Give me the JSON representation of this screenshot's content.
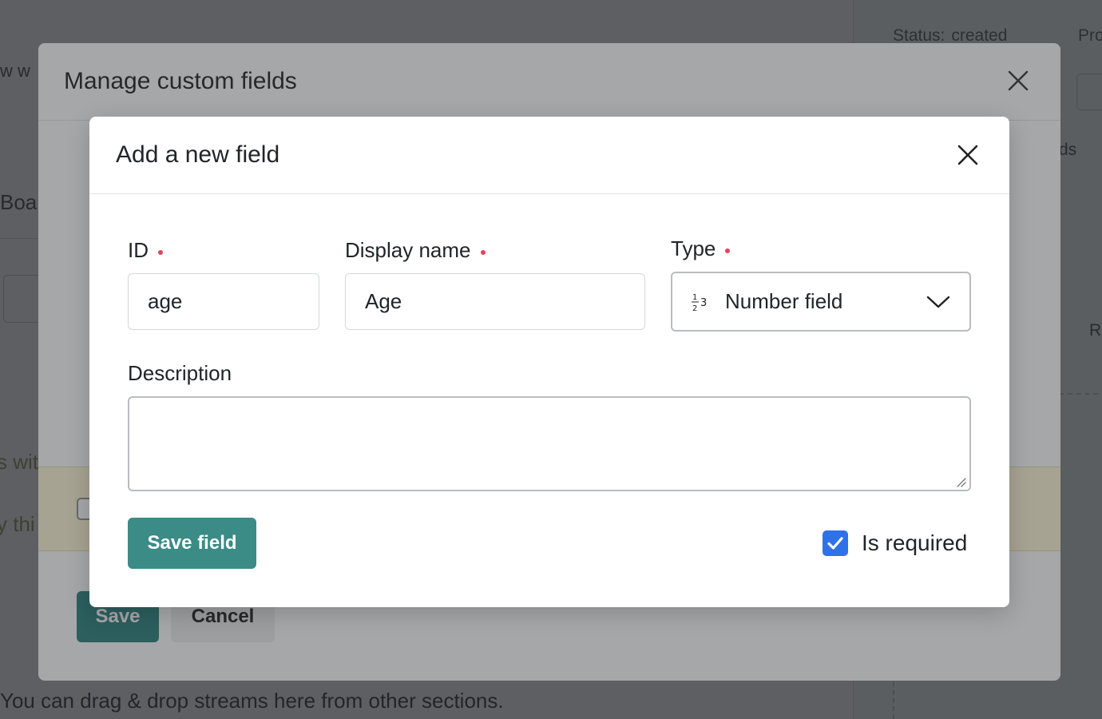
{
  "background": {
    "fragment_top_left": "w w",
    "fragment_board": "Boa",
    "status_label": "Status:",
    "status_value": "created",
    "fragment_pro": "Pro",
    "fragment_ds": "ds",
    "fragment_r": "R",
    "banner_fragment_1": "s wit",
    "banner_fragment_2": "y thi",
    "hint": "You can drag & drop streams here from other sections."
  },
  "outer_modal": {
    "title": "Manage custom fields",
    "save_label": "Save",
    "cancel_label": "Cancel"
  },
  "inner_modal": {
    "title": "Add a new field",
    "fields": {
      "id_label": "ID",
      "id_value": "age",
      "display_name_label": "Display name",
      "display_name_value": "Age",
      "type_label": "Type",
      "type_value": "Number field",
      "description_label": "Description",
      "description_value": ""
    },
    "save_field_label": "Save field",
    "is_required_label": "Is required",
    "is_required_checked": true
  },
  "colors": {
    "primary_button": "#3b8b86",
    "required_dot": "#e0445b",
    "checkbox": "#2f72e8"
  },
  "icons": {
    "close": "close-icon",
    "type_number": "number-type-icon",
    "dropdown": "chevron-down-icon",
    "check": "check-icon"
  }
}
